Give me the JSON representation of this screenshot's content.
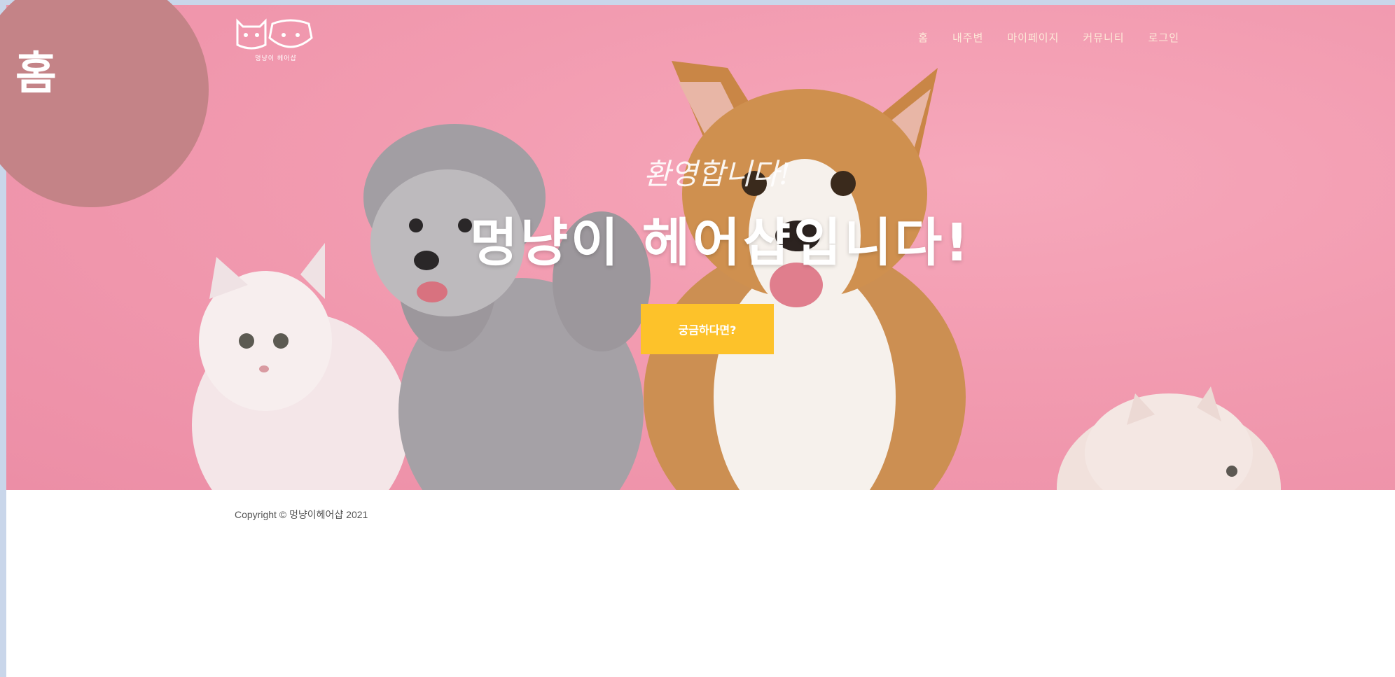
{
  "badge": {
    "label": "홈"
  },
  "header": {
    "logo_text": "멍냥이 헤어샵",
    "nav": [
      "홈",
      "내주변",
      "마이페이지",
      "커뮤니티",
      "로그인"
    ]
  },
  "hero": {
    "subtitle": "환영합니다!",
    "title": "멍냥이 헤어샵입니다!",
    "cta_label": "궁금하다면?"
  },
  "footer": {
    "copyright": "Copyright © 멍냥이헤어샵 2021"
  },
  "colors": {
    "hero_pink": "#f29bb0",
    "cta_yellow": "#fdc22a",
    "badge_rose": "#c48387",
    "page_border": "#c9d6ea"
  }
}
